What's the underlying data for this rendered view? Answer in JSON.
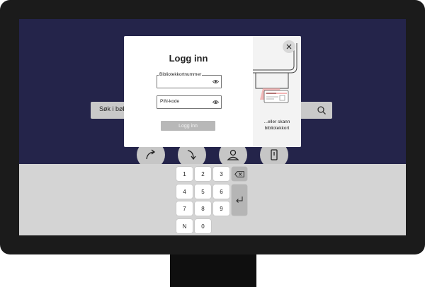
{
  "background": {
    "search_placeholder": "Søk i bøker",
    "round_buttons": [
      "redo-arrow-icon",
      "forward-arrow-icon",
      "person-icon",
      "phone-icon"
    ]
  },
  "keypad": {
    "rows": [
      [
        "1",
        "2",
        "3"
      ],
      [
        "4",
        "5",
        "6"
      ],
      [
        "7",
        "8",
        "9"
      ],
      [
        "N",
        "0"
      ]
    ],
    "backspace_icon": "backspace-icon",
    "enter_icon": "enter-icon"
  },
  "modal": {
    "title": "Logg inn",
    "card_label": "Bibliotekkortnummer",
    "pin_label": "PIN-kode",
    "login_button": "Logg inn",
    "scan_text_line1": "...eller skann",
    "scan_text_line2": "bibliotekkort",
    "close_icon": "close-icon"
  },
  "colors": {
    "screen_bg": "#24244a",
    "panel_bg": "#d4d4d4",
    "button_disabled": "#b8b8b8",
    "scanner_light": "#f2a5a5"
  }
}
